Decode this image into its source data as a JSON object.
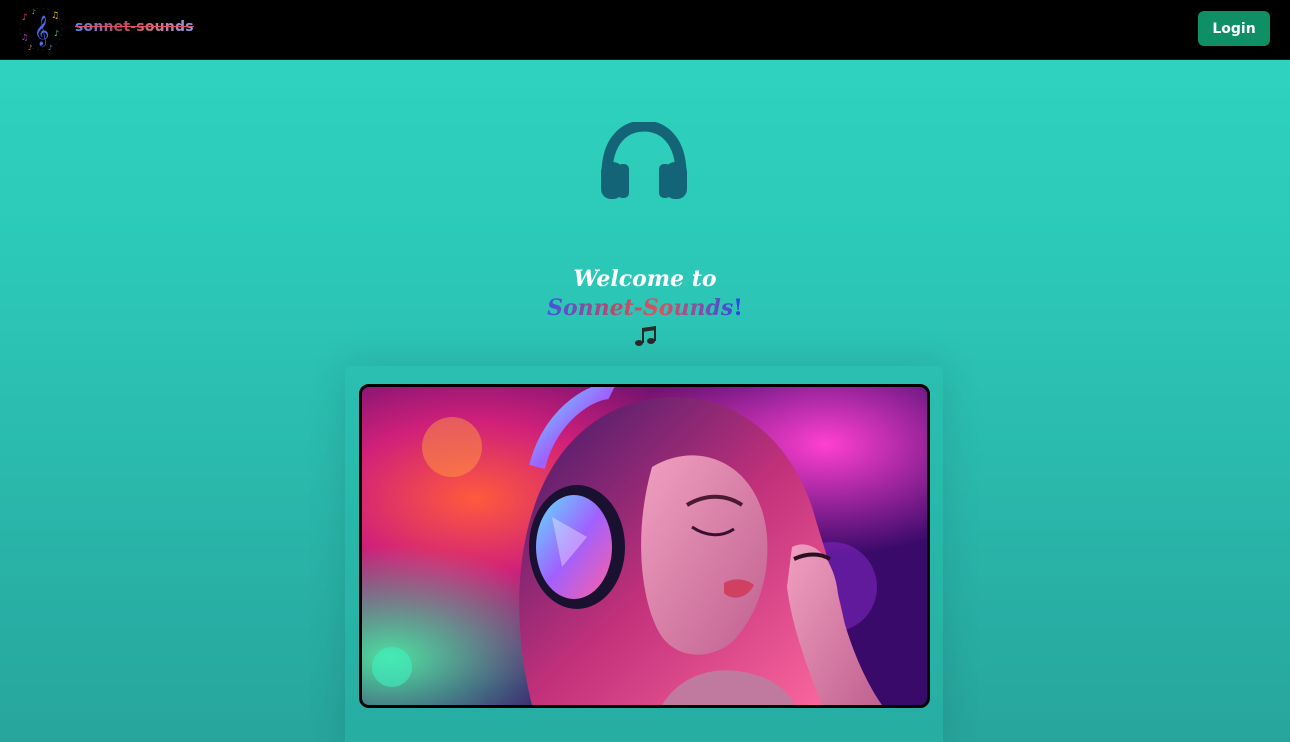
{
  "navbar": {
    "brand": "sonnet-sounds",
    "logo_icon": "music-notes-logo-icon",
    "login_label": "Login"
  },
  "hero": {
    "icon": "headphones-icon",
    "welcome_line1": "Welcome to",
    "welcome_brand": "Sonnet-Sounds",
    "welcome_exclaim": "!",
    "notes_icon": "music-notes-icon"
  },
  "image": {
    "alt": "Woman wearing headphones with neon lights"
  },
  "colors": {
    "accent": "#0e8f66",
    "icon": "#146478",
    "background_top": "#2ed6c0",
    "background_bottom": "#27a59c"
  }
}
